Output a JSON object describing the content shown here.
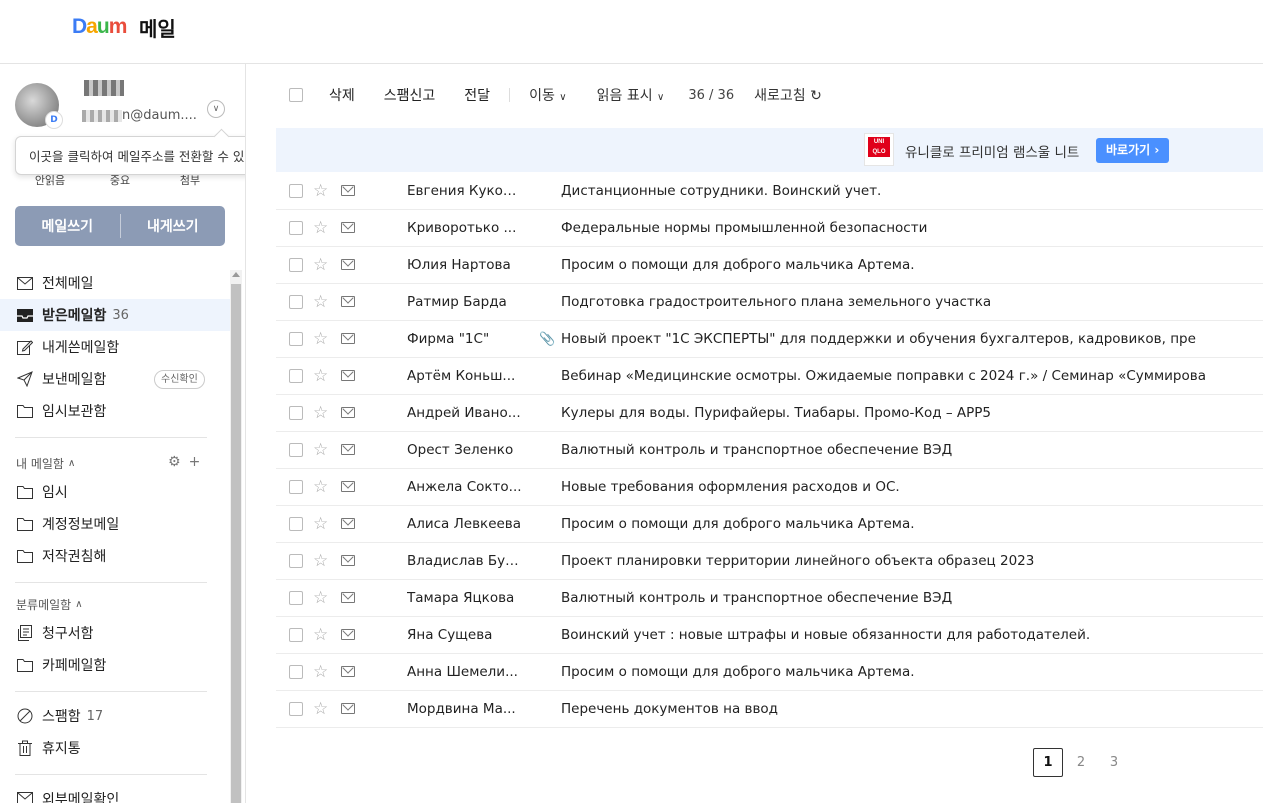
{
  "header": {
    "logo_letters": [
      "D",
      "a",
      "u",
      "m"
    ],
    "logo_colors": [
      "#3b7cf5",
      "#f7a600",
      "#3bb64a",
      "#e94d3c"
    ],
    "title": "메일"
  },
  "account": {
    "email_visible": "n@daum....",
    "tooltip": "이곳을 클릭하여 메일주소를 전환할 수 있습니다.",
    "badge_letter": "D",
    "stats": [
      "안읽음",
      "중요",
      "첨부"
    ]
  },
  "compose": {
    "write": "메일쓰기",
    "self": "내게쓰기"
  },
  "nav": {
    "items": [
      {
        "label": "전체메일",
        "count": "",
        "icon": "mail-icon"
      },
      {
        "label": "받은메일함",
        "count": "36",
        "icon": "inbox-icon"
      },
      {
        "label": "내게쓴메일함",
        "count": "",
        "icon": "edit-icon"
      },
      {
        "label": "보낸메일함",
        "count": "",
        "icon": "send-icon",
        "badge": "수신확인"
      },
      {
        "label": "임시보관함",
        "count": "",
        "icon": "folder-icon"
      }
    ],
    "my_mailbox_title": "내 메일함",
    "my_mailboxes": [
      "임시",
      "계정정보메일",
      "저작권침해"
    ],
    "category_title": "분류메일함",
    "categories": [
      "청구서함",
      "카페메일함"
    ],
    "spam": {
      "label": "스팸함",
      "count": "17"
    },
    "trash": "휴지통",
    "external": "외부메일확인"
  },
  "toolbar": {
    "delete": "삭제",
    "spam": "스팸신고",
    "forward": "전달",
    "move": "이동",
    "mark_read": "읽음 표시",
    "count": "36 / 36",
    "refresh": "새로고침"
  },
  "ad": {
    "logo_top": "UNI",
    "logo_bottom": "QLO",
    "text": "유니클로 프리미엄 램스울 니트",
    "button": "바로가기"
  },
  "mails": [
    {
      "sender": "Евгения Кукол...",
      "subject": "Дистанционные сотрудники. Воинский учет.",
      "attach": false
    },
    {
      "sender": "Криворотько ...",
      "subject": "Федеральные нормы промышленной безопасности",
      "attach": false
    },
    {
      "sender": "Юлия Нартова",
      "subject": "Просим о помощи для доброго мальчика Артема.",
      "attach": false
    },
    {
      "sender": "Ратмир Барда",
      "subject": "Подготовка градостроительного плана земельного участка",
      "attach": false
    },
    {
      "sender": "Фирма \"1С\"",
      "subject": "Новый проект \"1С ЭКСПЕРТЫ\" для поддержки и обучения бухгалтеров, кадровиков, пре",
      "attach": true
    },
    {
      "sender": "Артём Коньш...",
      "subject": "Вебинар «Медицинские осмотры. Ожидаемые поправки с 2024 г.» / Семинар «Суммирова",
      "attach": false
    },
    {
      "sender": "Андрей Ивано...",
      "subject": "Кулеры для воды. Пурифайеры. Тиабары. Промо-Код – APP5",
      "attach": false
    },
    {
      "sender": "Орест Зеленко",
      "subject": "Валютный контроль и транспортное обеспечение ВЭД",
      "attach": false
    },
    {
      "sender": "Анжела Сокто...",
      "subject": "Новые требования оформления расходов и ОС.",
      "attach": false
    },
    {
      "sender": "Алиса Левкеева",
      "subject": "Просим о помощи для доброго мальчика Артема.",
      "attach": false
    },
    {
      "sender": "Владислав Буг...",
      "subject": "Проект планировки территории линейного объекта образец 2023",
      "attach": false
    },
    {
      "sender": "Тамара Яцкова",
      "subject": "Валютный контроль и транспортное обеспечение ВЭД",
      "attach": false
    },
    {
      "sender": "Яна Сущева",
      "subject": "Воинский учет : новые штрафы и новые обязанности для работодателей.",
      "attach": false
    },
    {
      "sender": "Анна Шемели...",
      "subject": "Просим о помощи для доброго мальчика Артема.",
      "attach": false
    },
    {
      "sender": "Мордвина Ма...",
      "subject": "Перечень документов на ввод",
      "attach": false
    }
  ],
  "pagination": {
    "pages": [
      "1",
      "2",
      "3"
    ],
    "current": "1"
  }
}
